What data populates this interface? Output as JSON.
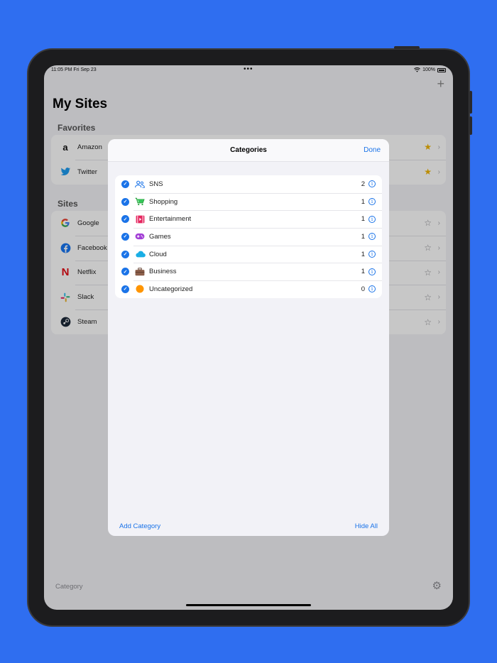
{
  "status": {
    "time": "11:05 PM  Fri Sep 23",
    "dots": "•••",
    "battery": "100%"
  },
  "main": {
    "title": "My Sites",
    "add_icon": "plus-icon",
    "favorites_header": "Favorites",
    "favorites": [
      {
        "label": "Amazon",
        "icon": "amazon-icon",
        "favorite": true
      },
      {
        "label": "Twitter",
        "icon": "twitter-icon",
        "favorite": true
      }
    ],
    "sites_header": "Sites",
    "sites": [
      {
        "label": "Google",
        "icon": "google-icon",
        "favorite": false
      },
      {
        "label": "Facebook",
        "icon": "facebook-icon",
        "favorite": false
      },
      {
        "label": "Netflix",
        "icon": "netflix-icon",
        "favorite": false
      },
      {
        "label": "Slack",
        "icon": "slack-icon",
        "favorite": false
      },
      {
        "label": "Steam",
        "icon": "steam-icon",
        "favorite": false
      }
    ]
  },
  "bottom": {
    "category_label": "Category",
    "settings_icon": "gear-icon"
  },
  "modal": {
    "title": "Categories",
    "done": "Done",
    "categories": [
      {
        "label": "SNS",
        "count": "2",
        "icon": "people-icon"
      },
      {
        "label": "Shopping",
        "count": "1",
        "icon": "cart-icon"
      },
      {
        "label": "Entertainment",
        "count": "1",
        "icon": "film-icon"
      },
      {
        "label": "Games",
        "count": "1",
        "icon": "gamepad-icon"
      },
      {
        "label": "Cloud",
        "count": "1",
        "icon": "cloud-icon"
      },
      {
        "label": "Business",
        "count": "1",
        "icon": "briefcase-icon"
      },
      {
        "label": "Uncategorized",
        "count": "0",
        "icon": "orange-circle-icon"
      }
    ],
    "add_category": "Add Category",
    "hide_all": "Hide All"
  },
  "colors": {
    "accent": "#1a73e8",
    "background": "#2f6ef0",
    "star": "#f0b400"
  }
}
